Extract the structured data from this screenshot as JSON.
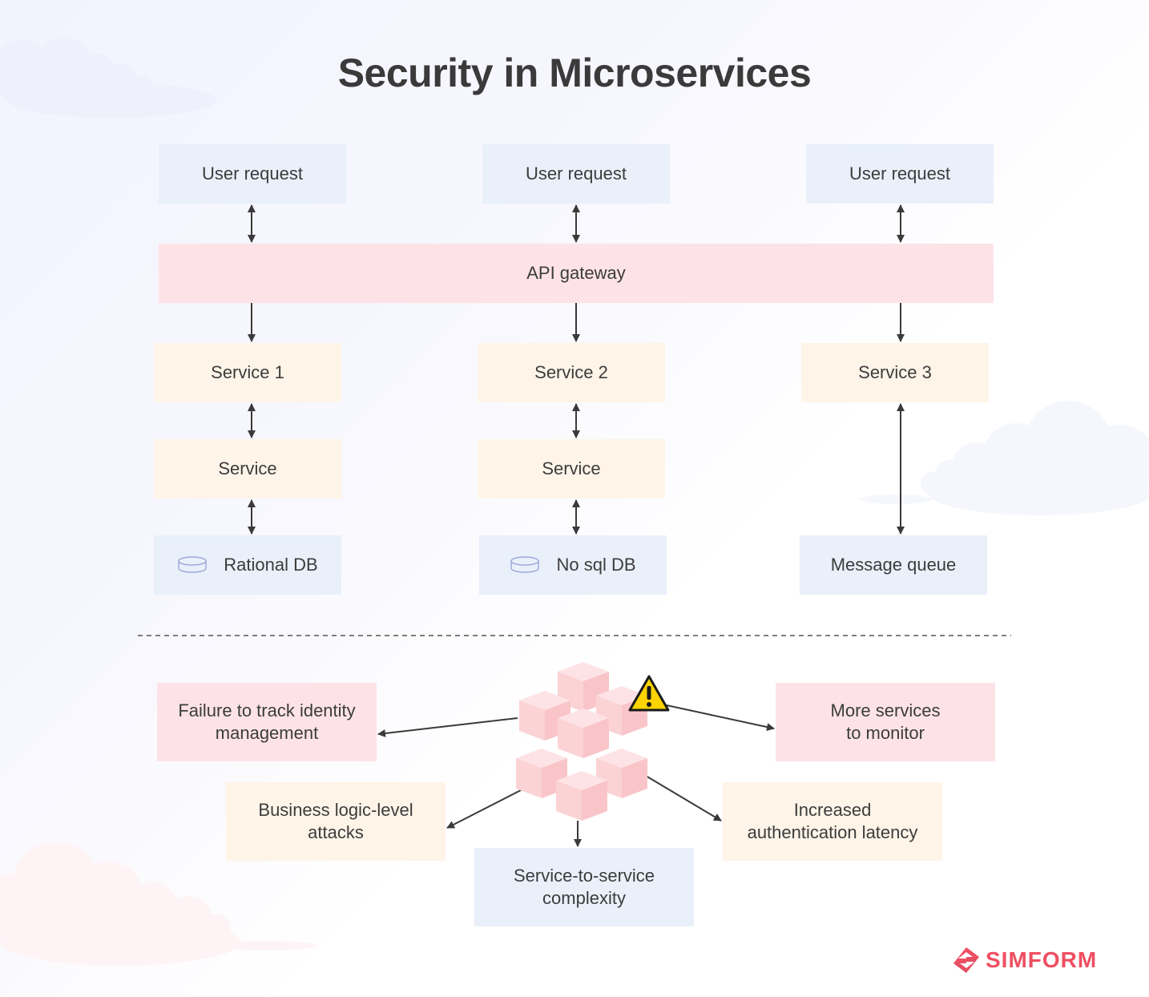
{
  "title": "Security in Microservices",
  "architecture": {
    "user_requests": [
      "User request",
      "User request",
      "User request"
    ],
    "gateway": "API gateway",
    "services": [
      "Service 1",
      "Service 2",
      "Service 3"
    ],
    "sub_services": [
      "Service",
      "Service"
    ],
    "data_stores": [
      {
        "label": "Rational DB",
        "icon": "database-icon"
      },
      {
        "label": "No sql DB",
        "icon": "database-icon"
      },
      {
        "label": "Message queue",
        "icon": ""
      }
    ]
  },
  "challenges": {
    "center_icon": "cubes-cluster-icon",
    "warning_icon": "warning-icon",
    "items": [
      "Failure to track identity management",
      "More services to monitor",
      "Business logic-level attacks",
      "Increased authentication latency",
      "Service-to-service complexity"
    ],
    "items_lines": {
      "identity": [
        "Failure to track identity",
        "management"
      ],
      "monitor": [
        "More services",
        "to monitor"
      ],
      "business": [
        "Business logic-level",
        "attacks"
      ],
      "latency": [
        "Increased",
        "authentication latency"
      ],
      "complexity": [
        "Service-to-service",
        "complexity"
      ]
    }
  },
  "brand": {
    "name": "SIMFORM",
    "color": "#ef4f62"
  },
  "colors": {
    "request_box": "#e9f0fa",
    "gateway_box": "#fde3e7",
    "service_box": "#fff4e8",
    "arrow": "#3a3a3a",
    "cube": "#f9c9cb"
  }
}
